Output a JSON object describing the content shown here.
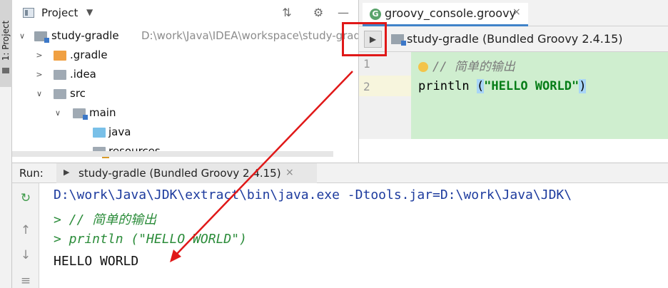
{
  "left_strip": {
    "tab_label": "1: Project"
  },
  "project": {
    "title": "Project",
    "tree": [
      {
        "label": "study-gradle",
        "path": "D:\\work\\Java\\IDEA\\workspace\\study-grad"
      },
      {
        "label": ".gradle"
      },
      {
        "label": ".idea"
      },
      {
        "label": "src"
      },
      {
        "label": "main"
      },
      {
        "label": "java"
      },
      {
        "label": "resources"
      }
    ]
  },
  "editor": {
    "tab_icon": "G",
    "tab_name": "groovy_console.groovy",
    "tab_close": "×",
    "run_icon": "▶",
    "toolbar_title": "study-gradle (Bundled Groovy 2.4.15)",
    "line_numbers": [
      "1",
      "2"
    ],
    "code": {
      "line1_comment": "// 简单的输出",
      "line2_fn": "println ",
      "line2_open": "(",
      "line2_str": "\"HELLO WORLD\"",
      "line2_close": ")"
    }
  },
  "run": {
    "label": "Run:",
    "tab_name": "study-gradle (Bundled Groovy 2.4.15)",
    "tab_close": "×",
    "console": [
      "D:\\work\\Java\\JDK\\extract\\bin\\java.exe -Dtools.jar=D:\\work\\Java\\JDK\\",
      "> // 简单的输出",
      "> println (\"HELLO WORLD\")",
      "HELLO WORLD"
    ]
  },
  "icons": {
    "rerun": "rerun-icon",
    "up": "arrow-up-icon",
    "down": "arrow-down-icon",
    "wrap": "soft-wrap-icon",
    "gear": "gear-icon",
    "collapse": "collapse-icon",
    "minimize": "minimize-icon"
  },
  "colors": {
    "annotation": "#e01818",
    "code_bg": "#cfeecf",
    "string": "#067d17",
    "console_path": "#1d3b9e"
  }
}
